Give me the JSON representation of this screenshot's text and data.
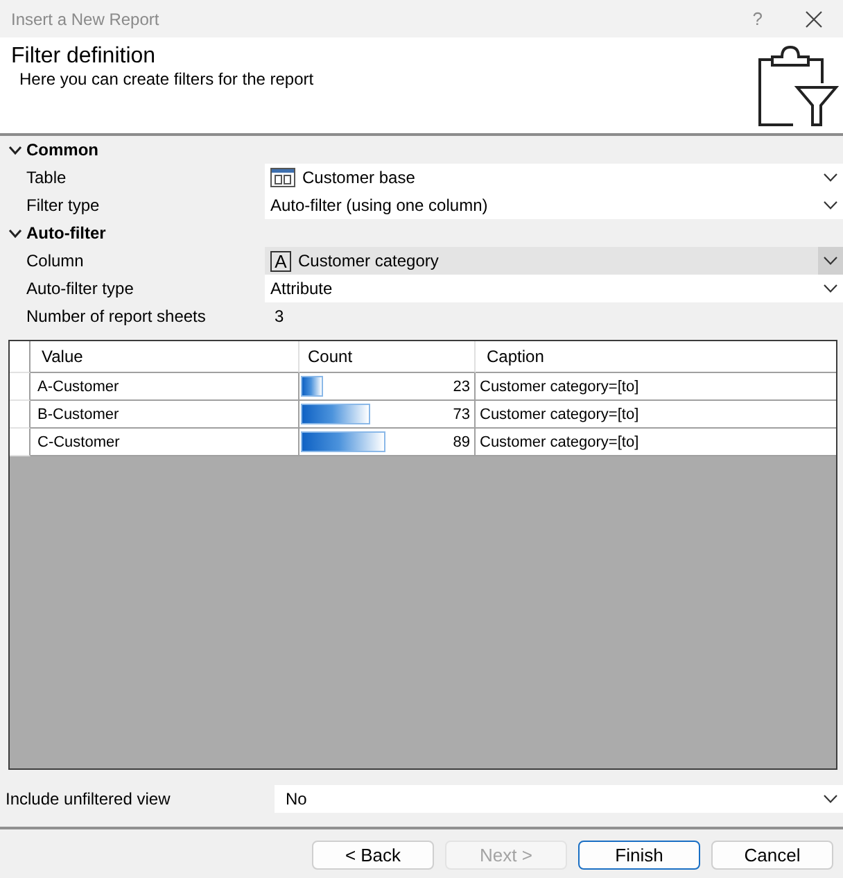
{
  "window": {
    "title": "Insert a New Report",
    "help": "?"
  },
  "header": {
    "title": "Filter definition",
    "subtitle": "Here you can create filters for the report"
  },
  "property_groups": [
    {
      "name": "Common",
      "expanded": true,
      "properties": [
        {
          "label": "Table",
          "value": "Customer base",
          "kind": "table_select",
          "selected": false
        },
        {
          "label": "Filter type",
          "value": "Auto-filter (using one column)",
          "kind": "select",
          "selected": false
        }
      ]
    },
    {
      "name": "Auto-filter",
      "expanded": true,
      "properties": [
        {
          "label": "Column",
          "value": "Customer category",
          "kind": "column_select",
          "glyph": "A",
          "selected": true
        },
        {
          "label": "Auto-filter type",
          "value": "Attribute",
          "kind": "select",
          "selected": false
        },
        {
          "label": "Number of report sheets",
          "value": "3",
          "kind": "readonly",
          "selected": false
        }
      ]
    }
  ],
  "table": {
    "columns": [
      "Value",
      "Count",
      "Caption"
    ],
    "rows": [
      {
        "value": "A-Customer",
        "count": "23",
        "level": 0.124,
        "caption": "Customer category=[to]"
      },
      {
        "value": "B-Customer",
        "count": "73",
        "level": 0.395,
        "caption": "Customer category=[to]"
      },
      {
        "value": "C-Customer",
        "count": "89",
        "level": 0.481,
        "caption": "Customer category=[to]"
      }
    ]
  },
  "include_unfiltered": {
    "label": "Include unfiltered view",
    "value": "No"
  },
  "buttons": [
    {
      "label": "< Back",
      "disabled": false,
      "default": false
    },
    {
      "label": "Next >",
      "disabled": true,
      "default": false
    },
    {
      "label": "Finish",
      "disabled": false,
      "default": true
    },
    {
      "label": "Cancel",
      "disabled": false,
      "default": false
    }
  ]
}
